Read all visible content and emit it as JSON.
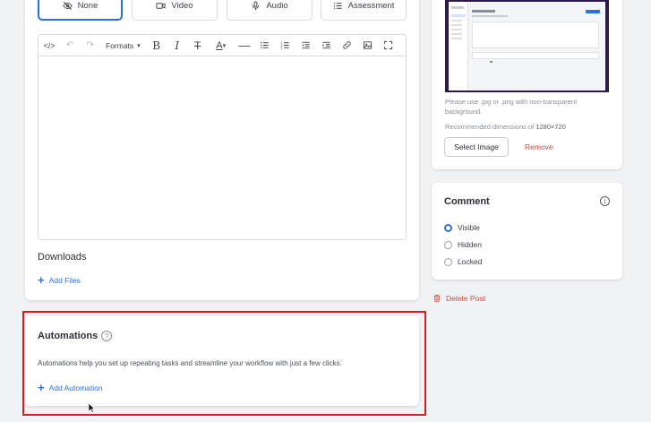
{
  "post_type": {
    "options": [
      {
        "label": "None",
        "icon": "eye-off-icon",
        "active": true
      },
      {
        "label": "Video",
        "icon": "video-icon",
        "active": false
      },
      {
        "label": "Audio",
        "icon": "microphone-icon",
        "active": false
      },
      {
        "label": "Assessment",
        "icon": "list-icon",
        "active": false
      }
    ]
  },
  "editor": {
    "toolbar": {
      "formats_label": "Formats"
    }
  },
  "downloads": {
    "title": "Downloads",
    "add_label": "Add Files"
  },
  "automations": {
    "title": "Automations",
    "description": "Automations help you set up repeating tasks and streamline your workflow with just a few clicks.",
    "add_label": "Add Automation"
  },
  "thumbnail": {
    "note_line1": "Please use .jpg or .png with non-transparent",
    "note_line2": "background.",
    "dimensions_prefix": "Recommended dimensions of ",
    "dimensions_value": "1280×720",
    "select_label": "Select Image",
    "remove_label": "Remove"
  },
  "comment": {
    "title": "Comment",
    "options": [
      {
        "label": "Visible",
        "checked": true
      },
      {
        "label": "Hidden",
        "checked": false
      },
      {
        "label": "Locked",
        "checked": false
      }
    ]
  },
  "delete_post_label": "Delete Post",
  "colors": {
    "accent": "#2f6fd6",
    "danger": "#d1493f",
    "highlight": "#d81e1e"
  }
}
